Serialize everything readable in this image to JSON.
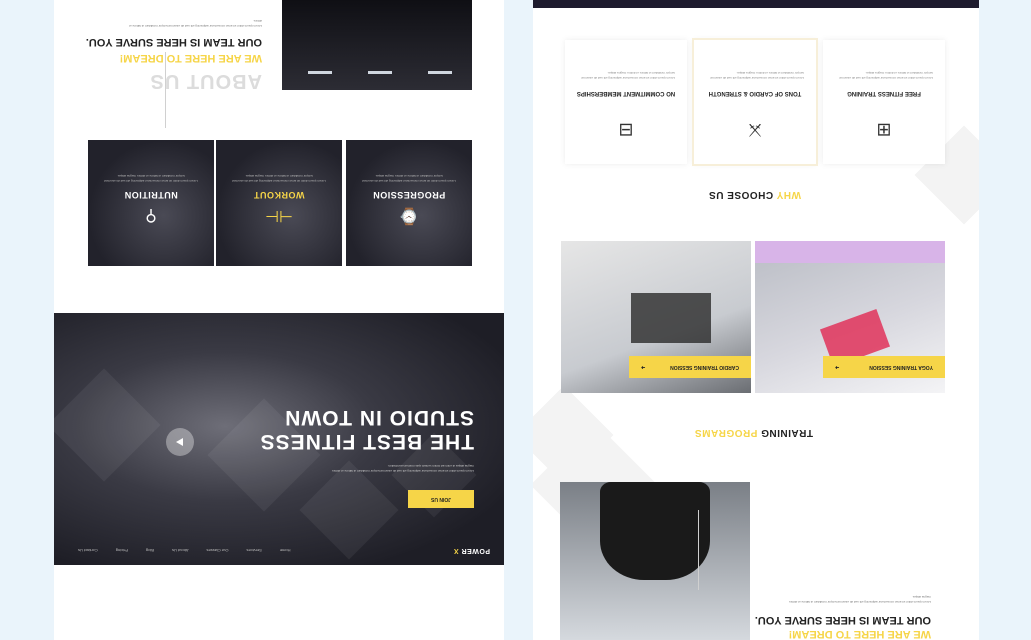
{
  "hero": {
    "logo_main": "POWER",
    "logo_accent": "X",
    "nav": [
      "Home",
      "Services",
      "Our Classes",
      "About Us",
      "Blog",
      "Pricing",
      "Contact Us"
    ],
    "title_line1": "THE BEST FITNESS",
    "title_line2": "STUDIO IN TOWN",
    "description": "Lorem ipsum dolor sit amet consectetur adipiscing elit sed do eiusmod tempor incididunt ut labore et dolore magna aliqua ut enim ad minim veniam quis nostrud exercitation.",
    "cta_label": "JOIN US",
    "play_icon": "play-icon"
  },
  "features": [
    {
      "icon": "progression-icon",
      "title": "PROGRESSION",
      "highlight": false,
      "description": "Lorem ipsum dolor sit amet consectetur adipiscing elit sed do eiusmod tempor incididunt ut labore et dolore magna aliqua."
    },
    {
      "icon": "workout-icon",
      "title": "WORKOUT",
      "highlight": true,
      "description": "Lorem ipsum dolor sit amet consectetur adipiscing elit sed do eiusmod tempor incididunt ut labore et dolore magna aliqua."
    },
    {
      "icon": "nutrition-icon",
      "title": "NUTRITION",
      "highlight": false,
      "description": "Lorem ipsum dolor sit amet consectetur adipiscing elit sed do eiusmod tempor incididunt ut labore et dolore magna aliqua."
    }
  ],
  "about": {
    "faint_title": "ABOUT US",
    "subtitle": "WE ARE HERE TO DREAM!",
    "title": "OUR TEAM IS HERE SURVE YOU.",
    "description": "Lorem ipsum dolor sit amet consectetur adipiscing elit sed do eiusmod tempor incididunt ut labore et dolore."
  },
  "why": {
    "title_accent": "WHY",
    "title_main": "CHOOSE US",
    "cards": [
      {
        "icon": "treadmill-icon",
        "title": "FREE FITNESS TRAINING",
        "description": "Lorem ipsum dolor sit amet consectetur adipiscing elit sed do eiusmod tempor incididunt ut labore et dolore magna aliqua."
      },
      {
        "icon": "cardio-icon",
        "title": "TONS OF CARDIO & STRENGTH",
        "description": "Lorem ipsum dolor sit amet consectetur adipiscing elit sed do eiusmod tempor incididunt ut labore et dolore magna aliqua."
      },
      {
        "icon": "gym-machine-icon",
        "title": "NO COMMITMENT MEMBERSHIPS",
        "description": "Lorem ipsum dolor sit amet consectetur adipiscing elit sed do eiusmod tempor incididunt ut labore et dolore magna aliqua."
      }
    ]
  },
  "programs": {
    "title_main": "TRAINING",
    "title_accent": "PROGRAMS",
    "items": [
      {
        "label": "YOGA TRAINING SESSION",
        "arrow_icon": "arrow-right-icon"
      },
      {
        "label": "CARDIO TRAINING SESSION",
        "arrow_icon": "arrow-right-icon"
      }
    ]
  },
  "bottom": {
    "subtitle": "WE ARE HERE TO DREAM!",
    "title": "OUR TEAM IS HERE SURVE YOU.",
    "description": "Lorem ipsum dolor sit amet consectetur adipiscing elit sed do eiusmod tempor incididunt ut labore et dolore magna aliqua."
  },
  "colors": {
    "accent": "#f6d548",
    "dark": "#1e1b2e",
    "background": "#eaf4fb"
  }
}
